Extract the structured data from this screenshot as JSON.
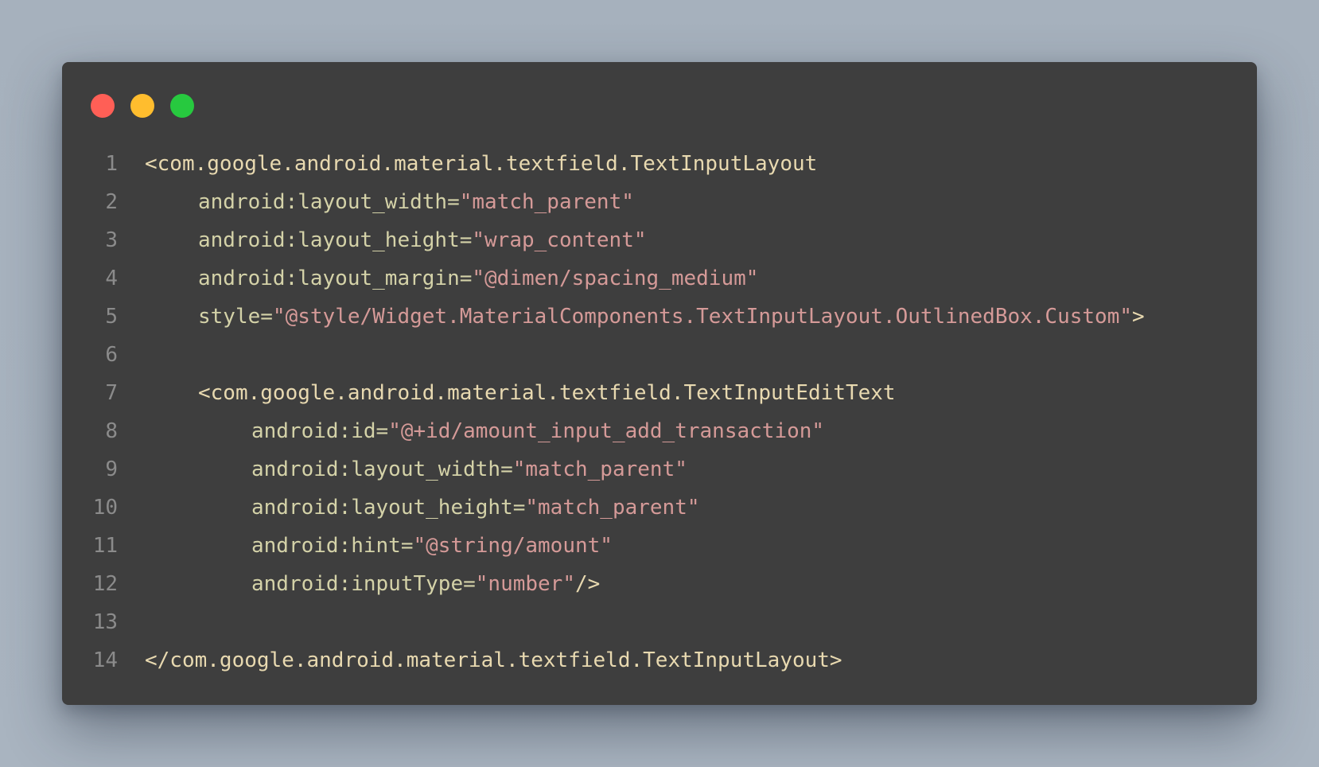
{
  "colors": {
    "background": "#a8b3bf",
    "window": "#3e3e3e",
    "traffic_red": "#ff5f56",
    "traffic_yellow": "#ffbd2e",
    "traffic_green": "#27c93f",
    "line_number": "#8b8b8b",
    "tag": "#e8d9b0",
    "attribute": "#d4d2a8",
    "string": "#d59a98"
  },
  "window_controls": [
    "close-dot",
    "minimize-dot",
    "maximize-dot"
  ],
  "code": {
    "line_numbers": [
      "1",
      "2",
      "3",
      "4",
      "5",
      "6",
      "7",
      "8",
      "9",
      "10",
      "11",
      "12",
      "13",
      "14"
    ],
    "l1": {
      "tag": "<com.google.android.material.textfield.TextInputLayout"
    },
    "l2": {
      "attr": "android:layout_width=",
      "val": "\"match_parent\""
    },
    "l3": {
      "attr": "android:layout_height=",
      "val": "\"wrap_content\""
    },
    "l4": {
      "attr": "android:layout_margin=",
      "val": "\"@dimen/spacing_medium\""
    },
    "l5": {
      "attr": "style=",
      "val": "\"@style/Widget.MaterialComponents.TextInputLayout.OutlinedBox.Custom\"",
      "end": ">"
    },
    "l7": {
      "tag": "<com.google.android.material.textfield.TextInputEditText"
    },
    "l8": {
      "attr": "android:id=",
      "val": "\"@+id/amount_input_add_transaction\""
    },
    "l9": {
      "attr": "android:layout_width=",
      "val": "\"match_parent\""
    },
    "l10": {
      "attr": "android:layout_height=",
      "val": "\"match_parent\""
    },
    "l11": {
      "attr": "android:hint=",
      "val": "\"@string/amount\""
    },
    "l12": {
      "attr": "android:inputType=",
      "val": "\"number\"",
      "end": "/>"
    },
    "l14": {
      "tag": "</com.google.android.material.textfield.TextInputLayout>"
    }
  }
}
